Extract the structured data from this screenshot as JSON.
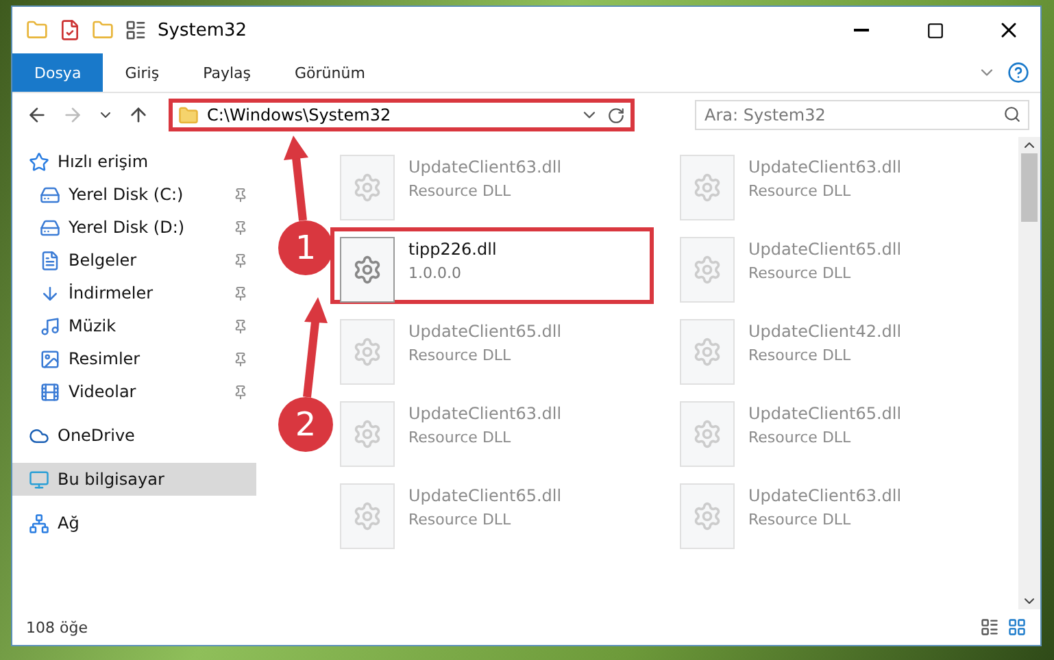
{
  "window": {
    "title": "System32"
  },
  "ribbon_tabs": [
    {
      "label": "Dosya",
      "selected": true
    },
    {
      "label": "Giriş",
      "selected": false
    },
    {
      "label": "Paylaş",
      "selected": false
    },
    {
      "label": "Görünüm",
      "selected": false
    }
  ],
  "address_bar": {
    "path": "C:\\Windows\\System32",
    "highlighted": true
  },
  "search": {
    "placeholder": "Ara: System32"
  },
  "sidebar": {
    "items": [
      {
        "label": "Hızlı erişim",
        "selected": false,
        "children": [
          {
            "label": "Yerel Disk (C:)",
            "pinned": true,
            "selected": false
          },
          {
            "label": "Yerel Disk (D:)",
            "pinned": true,
            "selected": false
          },
          {
            "label": "Belgeler",
            "pinned": true,
            "selected": false
          },
          {
            "label": "İndirmeler",
            "pinned": true,
            "selected": false
          },
          {
            "label": "Müzik",
            "pinned": true,
            "selected": false
          },
          {
            "label": "Resimler",
            "pinned": true,
            "selected": false
          },
          {
            "label": "Videolar",
            "pinned": true,
            "selected": false
          }
        ]
      },
      {
        "label": "OneDrive",
        "selected": false
      },
      {
        "label": "Bu bilgisayar",
        "selected": true
      },
      {
        "label": "Ağ",
        "selected": false
      }
    ]
  },
  "files": [
    {
      "name": "UpdateClient63.dll",
      "detail": "Resource DLL",
      "dimmed": true,
      "highlighted": false
    },
    {
      "name": "UpdateClient63.dll",
      "detail": "Resource DLL",
      "dimmed": true,
      "highlighted": false
    },
    {
      "name": "tipp226.dll",
      "detail": "1.0.0.0",
      "dimmed": false,
      "highlighted": true
    },
    {
      "name": "UpdateClient65.dll",
      "detail": "Resource DLL",
      "dimmed": true,
      "highlighted": false
    },
    {
      "name": "UpdateClient65.dll",
      "detail": "Resource DLL",
      "dimmed": true,
      "highlighted": false
    },
    {
      "name": "UpdateClient42.dll",
      "detail": "Resource DLL",
      "dimmed": true,
      "highlighted": false
    },
    {
      "name": "UpdateClient63.dll",
      "detail": "Resource DLL",
      "dimmed": true,
      "highlighted": false
    },
    {
      "name": "UpdateClient65.dll",
      "detail": "Resource DLL",
      "dimmed": true,
      "highlighted": false
    },
    {
      "name": "UpdateClient65.dll",
      "detail": "Resource DLL",
      "dimmed": true,
      "highlighted": false
    },
    {
      "name": "UpdateClient63.dll",
      "detail": "Resource DLL",
      "dimmed": true,
      "highlighted": false
    }
  ],
  "status_bar": {
    "count": "108 öğe"
  },
  "annotations": [
    {
      "number": "1"
    },
    {
      "number": "2"
    }
  ]
}
